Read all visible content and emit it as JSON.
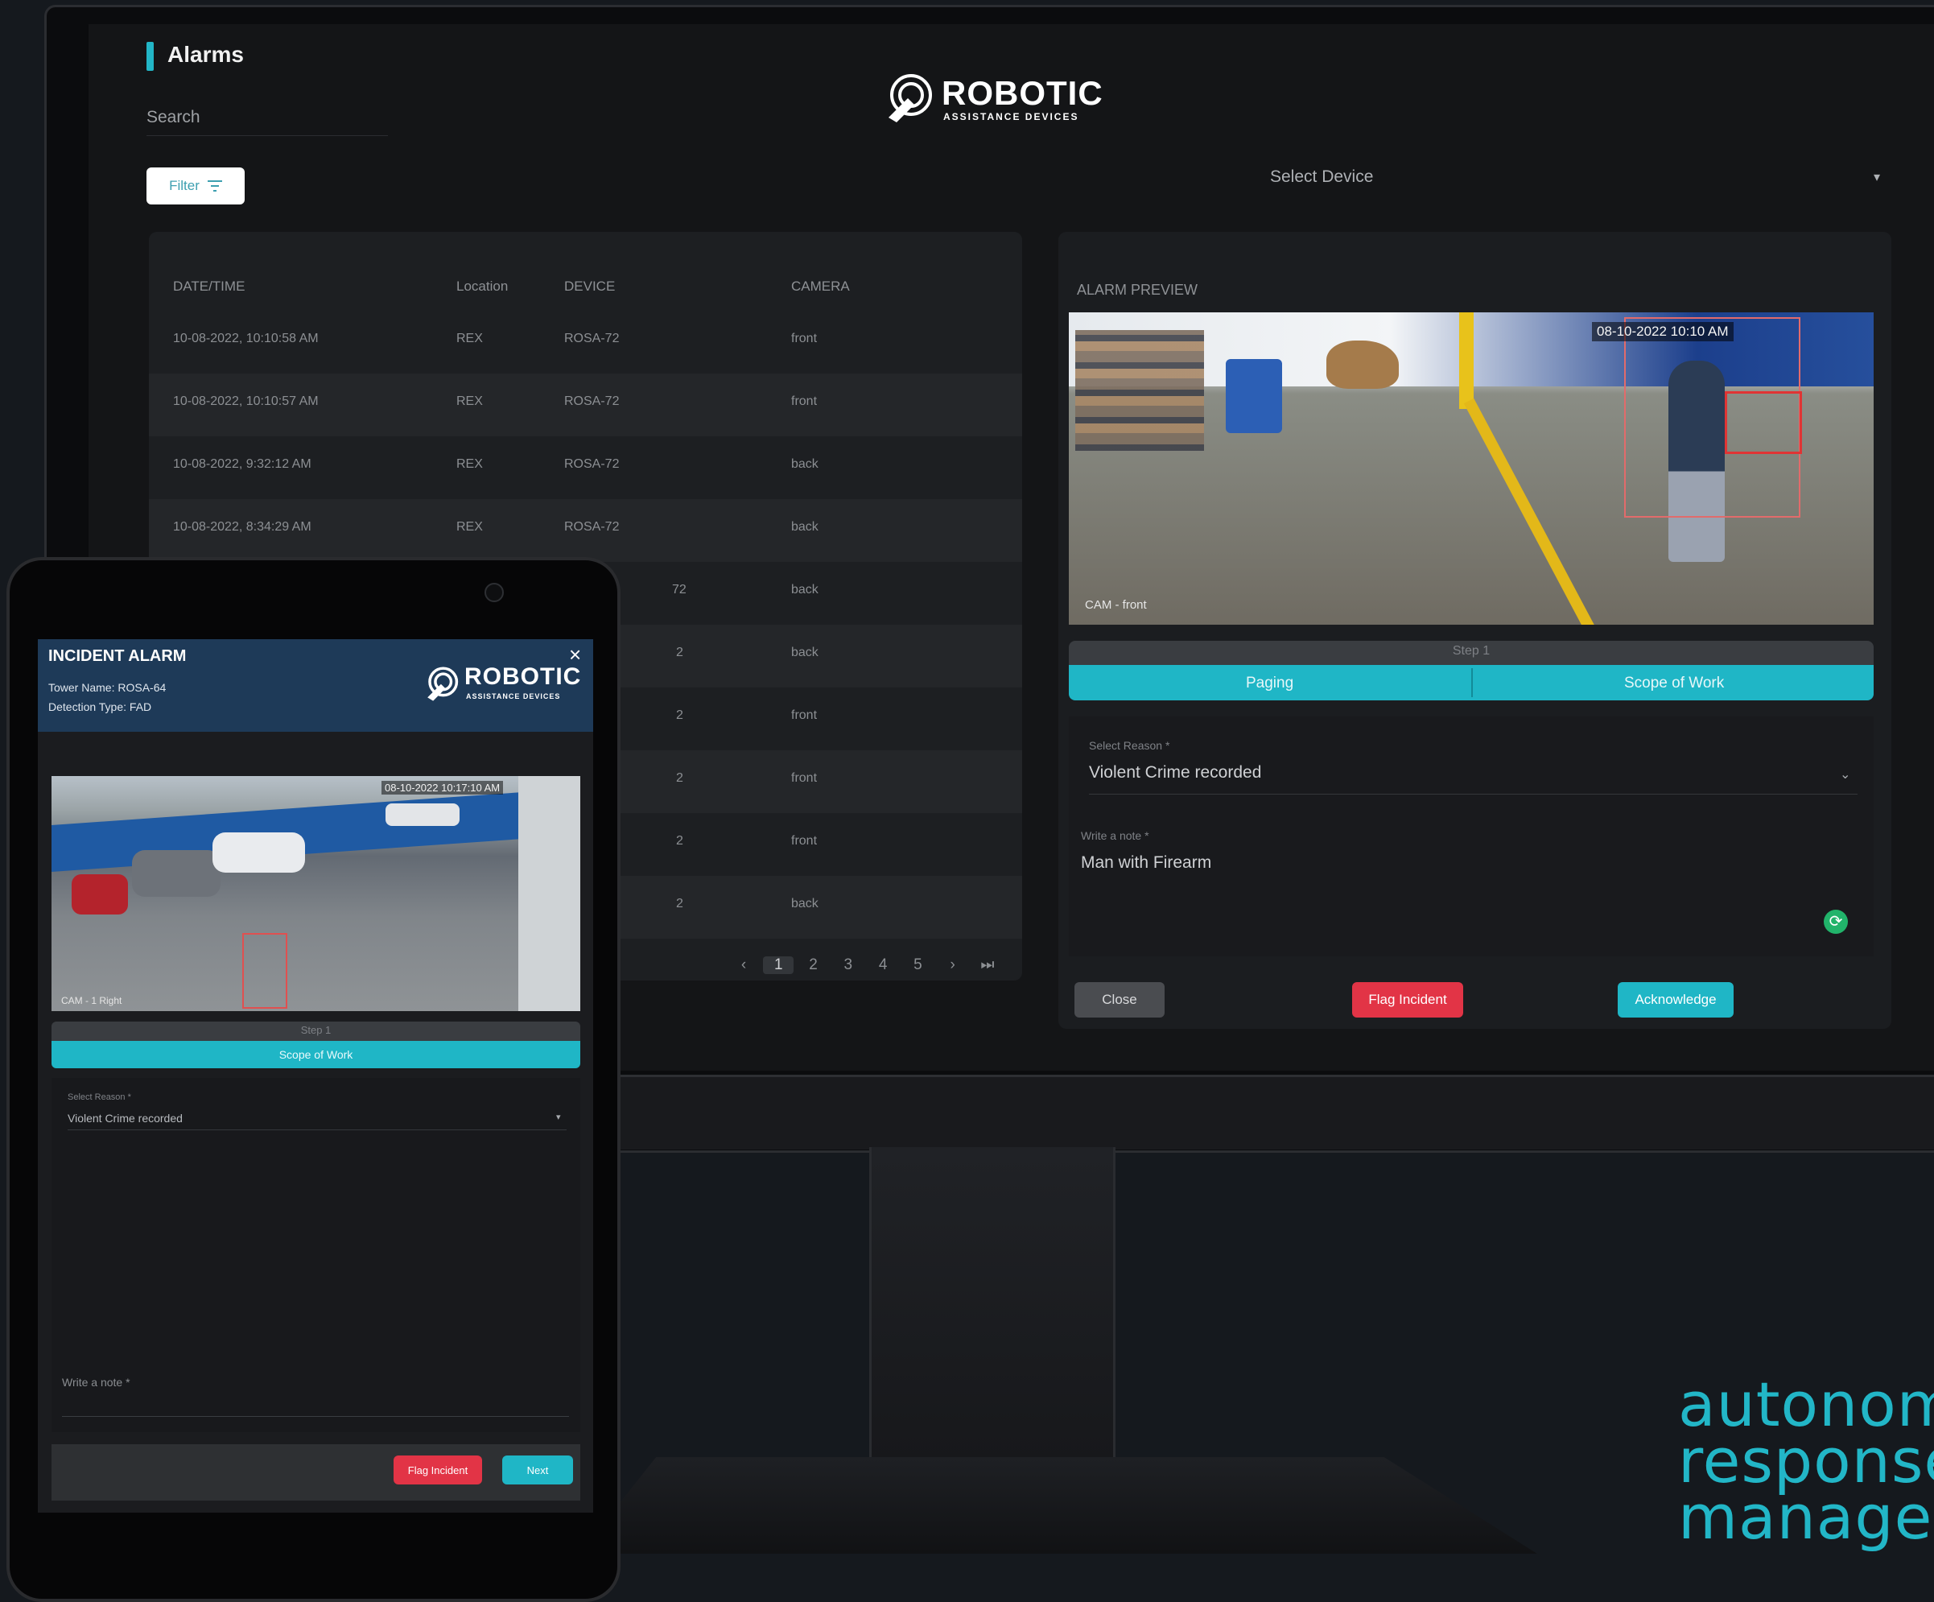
{
  "app": {
    "title": "Alarms",
    "search_label": "Search",
    "filter_label": "Filter",
    "filter_icon": "filter-icon",
    "logo": {
      "word": "ROBOTIC",
      "sub": "ASSISTANCE DEVICES"
    },
    "select_device_label": "Select Device",
    "accent_color": "#22b6c7"
  },
  "table": {
    "columns": [
      "DATE/TIME",
      "Location",
      "DEVICE",
      "CAMERA"
    ],
    "rows": [
      {
        "datetime": "10-08-2022, 10:10:58 AM",
        "location": "REX",
        "device": "ROSA-72",
        "camera": "front"
      },
      {
        "datetime": "10-08-2022, 10:10:57 AM",
        "location": "REX",
        "device": "ROSA-72",
        "camera": "front"
      },
      {
        "datetime": "10-08-2022, 9:32:12 AM",
        "location": "REX",
        "device": "ROSA-72",
        "camera": "back"
      },
      {
        "datetime": "10-08-2022, 8:34:29 AM",
        "location": "REX",
        "device": "ROSA-72",
        "camera": "back"
      },
      {
        "device": "72",
        "camera": "back"
      },
      {
        "device": "2",
        "camera": "back"
      },
      {
        "device": "2",
        "camera": "front"
      },
      {
        "device": "2",
        "camera": "front"
      },
      {
        "device": "2",
        "camera": "front"
      },
      {
        "device": "2",
        "camera": "back"
      }
    ],
    "pagination": {
      "prev": "‹",
      "pages": [
        "1",
        "2",
        "3",
        "4",
        "5"
      ],
      "next": "›",
      "last": "⏭",
      "current": "1"
    }
  },
  "preview": {
    "title": "ALARM PREVIEW",
    "feed_timestamp": "08-10-2022 10:10 AM",
    "feed_camera": "CAM - front",
    "step_label": "Step 1",
    "tabs": [
      "Paging",
      "Scope of Work"
    ],
    "reason_label": "Select Reason *",
    "reason_value": "Violent Crime recorded",
    "note_label": "Write a note *",
    "note_value": "Man with Firearm",
    "buttons": {
      "close": "Close",
      "flag": "Flag Incident",
      "acknowledge": "Acknowledge"
    },
    "colors": {
      "flag": "#e23446",
      "acknowledge": "#1fb6c6"
    }
  },
  "tablet": {
    "header_title": "INCIDENT ALARM",
    "tower_name": "Tower Name: ROSA-64",
    "detection_type": "Detection Type: FAD",
    "close_icon": "×",
    "logo": {
      "word": "ROBOTIC",
      "sub": "ASSISTANCE DEVICES"
    },
    "feed_timestamp": "08-10-2022 10:17:10 AM",
    "feed_camera": "CAM - 1 Right",
    "step_label": "Step 1",
    "tab_label": "Scope of Work",
    "reason_label": "Select Reason *",
    "reason_value": "Violent Crime recorded",
    "note_label": "Write a note *",
    "buttons": {
      "flag": "Flag Incident",
      "next": "Next"
    },
    "header_color": "#1e3a58"
  },
  "tagline": {
    "line1": "autonomous",
    "line2": "response",
    "line3": "management"
  }
}
